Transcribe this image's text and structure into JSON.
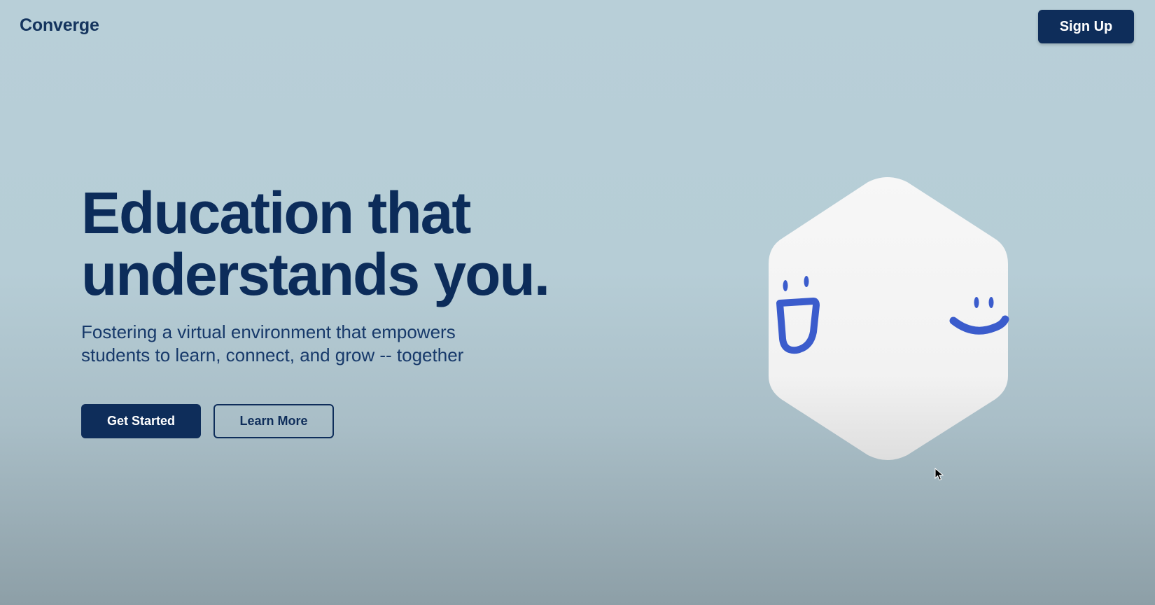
{
  "header": {
    "logo": "Converge",
    "signup_label": "Sign Up"
  },
  "hero": {
    "title_line1": "Education that",
    "title_line2": "understands you.",
    "subtitle_line1": "Fostering a virtual environment that empowers",
    "subtitle_line2": "students to learn, connect, and grow -- together"
  },
  "actions": {
    "primary_label": "Get Started",
    "secondary_label": "Learn More"
  },
  "illustration": {
    "icon": "smiling-hexagon-mascot-icon",
    "face_color": "#3b5ccc",
    "body_color": "#f5f5f5"
  },
  "colors": {
    "brand_navy": "#0e2d5a",
    "background": "#b6cdd6"
  }
}
